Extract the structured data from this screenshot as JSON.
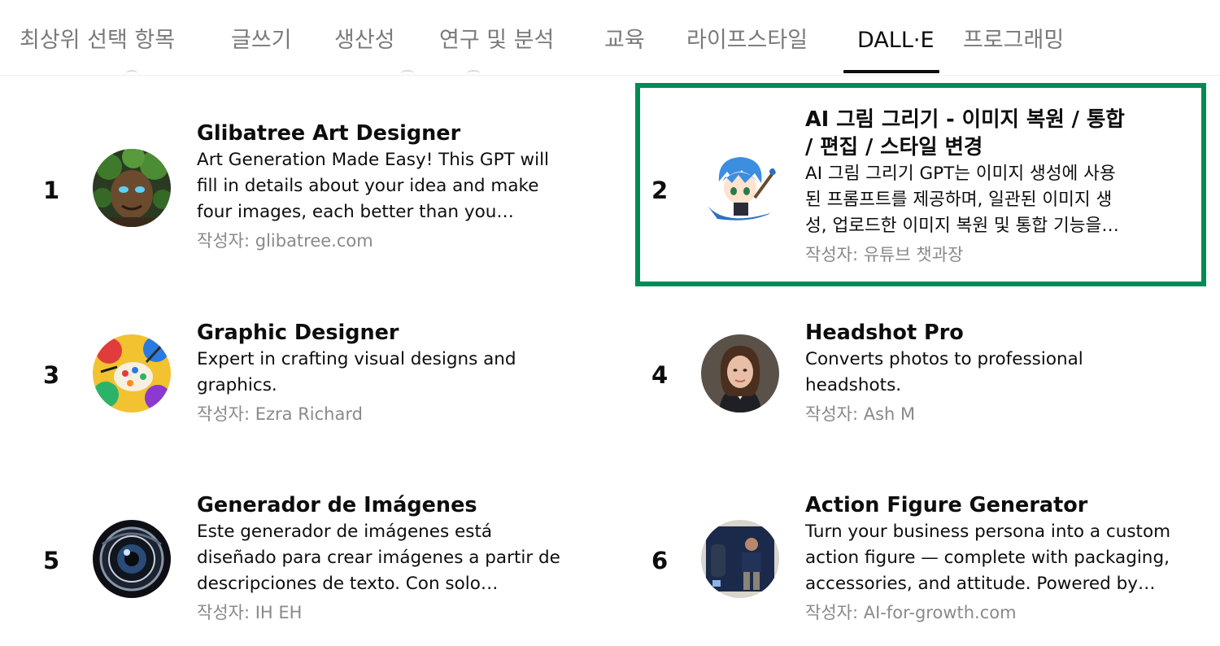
{
  "tabs": [
    {
      "label": "최상위 선택 항목"
    },
    {
      "label": "글쓰기"
    },
    {
      "label": "생산성"
    },
    {
      "label": "연구 및 분석"
    },
    {
      "label": "교육"
    },
    {
      "label": "라이프스타일"
    },
    {
      "label": "DALL·E"
    },
    {
      "label": "프로그래밍"
    }
  ],
  "active_tab": "DALL·E",
  "author_prefix": "작성자:",
  "colors": {
    "highlight_border": "#008a55",
    "muted_text": "#8a8a8a"
  },
  "cards": [
    {
      "rank": "1",
      "title": "Glibatree Art Designer",
      "desc": [
        "Art Generation Made Easy! This GPT will",
        "fill in details about your idea and make",
        "four images, each better than you…"
      ],
      "author": "glibatree.com",
      "icon": "tree-face-avatar-icon"
    },
    {
      "rank": "2",
      "title": [
        "AI 그림 그리기 - 이미지 복원 / 통합",
        "/ 편집 / 스타일 변경"
      ],
      "desc": [
        "AI 그림 그리기 GPT는 이미지 생성에 사용",
        "된 프롬프트를 제공하며, 일관된 이미지 생",
        "성, 업로드한 이미지 복원 및 통합 기능을…"
      ],
      "author": "유튜브 챗과장",
      "icon": "anime-painter-avatar-icon"
    },
    {
      "rank": "3",
      "title": "Graphic Designer",
      "desc": [
        "Expert in crafting visual designs and",
        "graphics."
      ],
      "author": "Ezra Richard",
      "icon": "colorful-palette-avatar-icon"
    },
    {
      "rank": "4",
      "title": "Headshot Pro",
      "desc": [
        "Converts photos to professional",
        "headshots."
      ],
      "author": "Ash M",
      "icon": "woman-portrait-avatar-icon"
    },
    {
      "rank": "5",
      "title": "Generador de Imágenes",
      "desc": [
        "Este generador de imágenes está",
        "diseñado para crear imágenes a partir de",
        "descripciones de texto. Con solo…"
      ],
      "author": "IH EH",
      "icon": "camera-lens-avatar-icon"
    },
    {
      "rank": "6",
      "title": "Action Figure Generator",
      "desc": [
        "Turn your business persona into a custom",
        "action figure — complete with packaging,",
        "accessories, and attitude. Powered by…"
      ],
      "author": "AI-for-growth.com",
      "icon": "action-figure-box-avatar-icon"
    }
  ]
}
